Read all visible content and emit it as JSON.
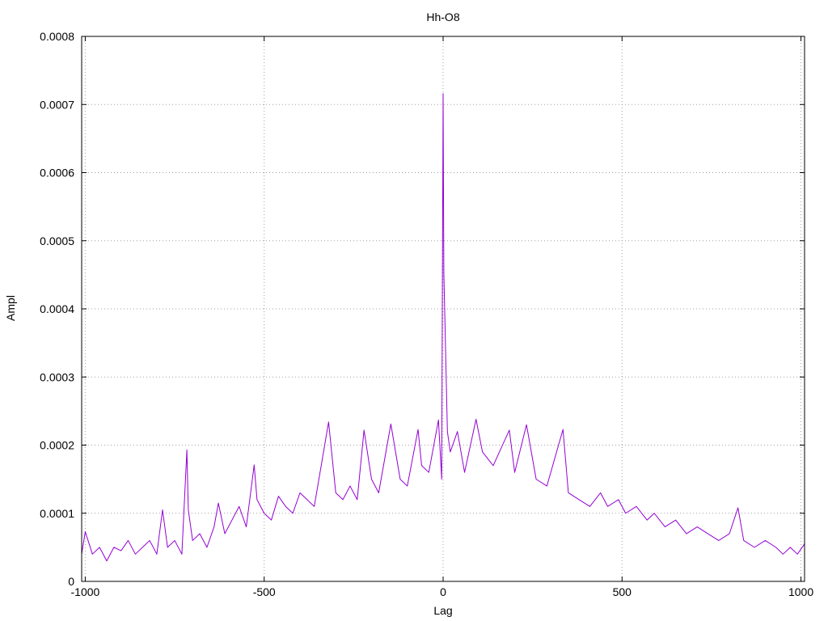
{
  "chart_data": {
    "type": "line",
    "title": "Hh-O8",
    "xlabel": "Lag",
    "ylabel": "Ampl",
    "xlim": [
      -1010,
      1010
    ],
    "ylim": [
      0,
      0.0008
    ],
    "x_ticks": [
      -1000,
      -500,
      0,
      500,
      1000
    ],
    "x_tick_labels": [
      "-1000",
      "-500",
      "0",
      "500",
      "1000"
    ],
    "y_ticks": [
      0,
      0.0001,
      0.0002,
      0.0003,
      0.0004,
      0.0005,
      0.0006,
      0.0007,
      0.0008
    ],
    "y_tick_labels": [
      "0",
      "0.0001",
      "0.0002",
      "0.0003",
      "0.0004",
      "0.0005",
      "0.0006",
      "0.0007",
      "0.0008"
    ],
    "grid": true,
    "series_color": "#9400d3",
    "series": [
      {
        "points": [
          [
            -1010,
            4e-05
          ],
          [
            -1000,
            7.3e-05
          ],
          [
            -980,
            4e-05
          ],
          [
            -960,
            5e-05
          ],
          [
            -940,
            3e-05
          ],
          [
            -920,
            5e-05
          ],
          [
            -900,
            4.5e-05
          ],
          [
            -880,
            6e-05
          ],
          [
            -860,
            4e-05
          ],
          [
            -840,
            5e-05
          ],
          [
            -820,
            6e-05
          ],
          [
            -800,
            4e-05
          ],
          [
            -784,
            0.000105
          ],
          [
            -770,
            5e-05
          ],
          [
            -750,
            6e-05
          ],
          [
            -730,
            4e-05
          ],
          [
            -716,
            0.000193
          ],
          [
            -712,
            0.000105
          ],
          [
            -700,
            6e-05
          ],
          [
            -680,
            7e-05
          ],
          [
            -660,
            5e-05
          ],
          [
            -640,
            8e-05
          ],
          [
            -628,
            0.000115
          ],
          [
            -610,
            7e-05
          ],
          [
            -590,
            9e-05
          ],
          [
            -570,
            0.00011
          ],
          [
            -550,
            8e-05
          ],
          [
            -528,
            0.000171
          ],
          [
            -520,
            0.00012
          ],
          [
            -500,
            0.0001
          ],
          [
            -480,
            9e-05
          ],
          [
            -460,
            0.000125
          ],
          [
            -440,
            0.00011
          ],
          [
            -420,
            0.0001
          ],
          [
            -400,
            0.00013
          ],
          [
            -380,
            0.00012
          ],
          [
            -360,
            0.00011
          ],
          [
            -320,
            0.000234
          ],
          [
            -300,
            0.00013
          ],
          [
            -280,
            0.00012
          ],
          [
            -260,
            0.00014
          ],
          [
            -240,
            0.00012
          ],
          [
            -221,
            0.000222
          ],
          [
            -200,
            0.00015
          ],
          [
            -180,
            0.00013
          ],
          [
            -146,
            0.000231
          ],
          [
            -120,
            0.00015
          ],
          [
            -100,
            0.00014
          ],
          [
            -70,
            0.000223
          ],
          [
            -60,
            0.00017
          ],
          [
            -40,
            0.00016
          ],
          [
            -13,
            0.000237
          ],
          [
            -4,
            0.00015
          ],
          [
            0,
            0.000716
          ],
          [
            2,
            0.000454
          ],
          [
            12,
            0.00022
          ],
          [
            20,
            0.00019
          ],
          [
            40,
            0.00022
          ],
          [
            60,
            0.00016
          ],
          [
            92,
            0.000238
          ],
          [
            110,
            0.00019
          ],
          [
            140,
            0.00017
          ],
          [
            185,
            0.000222
          ],
          [
            200,
            0.00016
          ],
          [
            233,
            0.00023
          ],
          [
            260,
            0.00015
          ],
          [
            290,
            0.00014
          ],
          [
            335,
            0.000223
          ],
          [
            350,
            0.00013
          ],
          [
            380,
            0.00012
          ],
          [
            410,
            0.00011
          ],
          [
            440,
            0.00013
          ],
          [
            460,
            0.00011
          ],
          [
            490,
            0.00012
          ],
          [
            510,
            0.0001
          ],
          [
            540,
            0.00011
          ],
          [
            570,
            9e-05
          ],
          [
            590,
            0.0001
          ],
          [
            620,
            8e-05
          ],
          [
            650,
            9e-05
          ],
          [
            680,
            7e-05
          ],
          [
            710,
            8e-05
          ],
          [
            740,
            7e-05
          ],
          [
            770,
            6e-05
          ],
          [
            800,
            7e-05
          ],
          [
            824,
            0.000108
          ],
          [
            840,
            6e-05
          ],
          [
            870,
            5e-05
          ],
          [
            900,
            6e-05
          ],
          [
            930,
            5e-05
          ],
          [
            950,
            4e-05
          ],
          [
            970,
            5e-05
          ],
          [
            990,
            4e-05
          ],
          [
            1010,
            5.5e-05
          ]
        ]
      }
    ]
  }
}
